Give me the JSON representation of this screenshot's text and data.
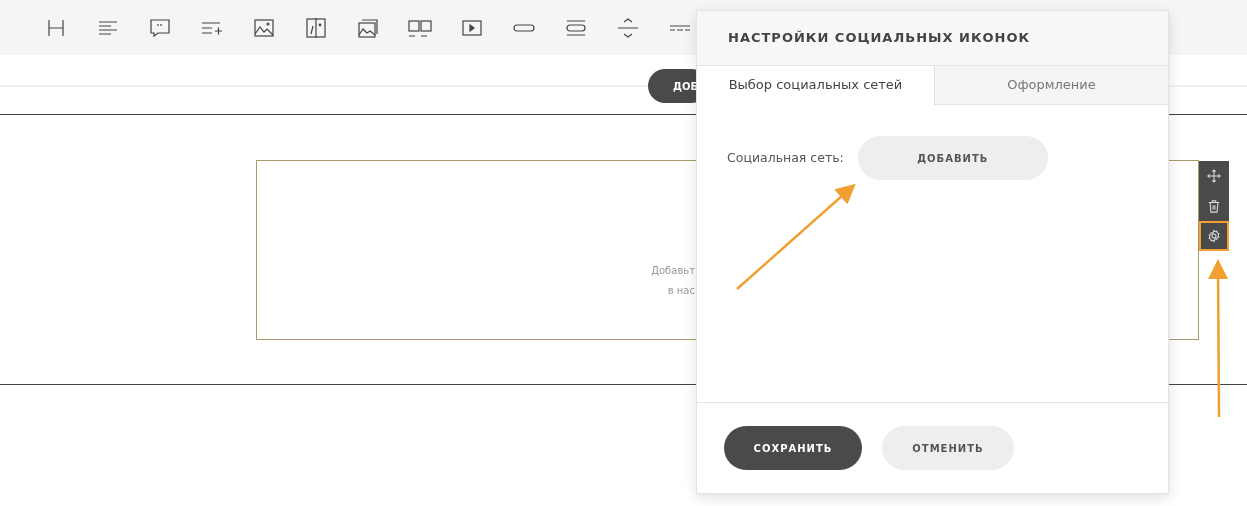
{
  "page": {
    "add_button": "ДОБ",
    "placeholder_lines": [
      "Добавьт",
      "в нас"
    ]
  },
  "block_controls": [
    {
      "kind": "move",
      "selected": false
    },
    {
      "kind": "delete",
      "selected": false
    },
    {
      "kind": "settings",
      "selected": true
    }
  ],
  "modal": {
    "title": "НАСТРОЙКИ СОЦИАЛЬНЫХ ИКОНОК",
    "tabs": [
      {
        "label": "Выбор социальных сетей",
        "selected": true
      },
      {
        "label": "Оформление",
        "selected": false
      }
    ],
    "field_label": "Социальная сеть:",
    "add_button": "ДОБАВИТЬ",
    "buttons": [
      {
        "label": "СОХРАНИТЬ",
        "kind": "primary"
      },
      {
        "label": "ОТМЕНИТЬ",
        "kind": "secondary"
      }
    ]
  }
}
